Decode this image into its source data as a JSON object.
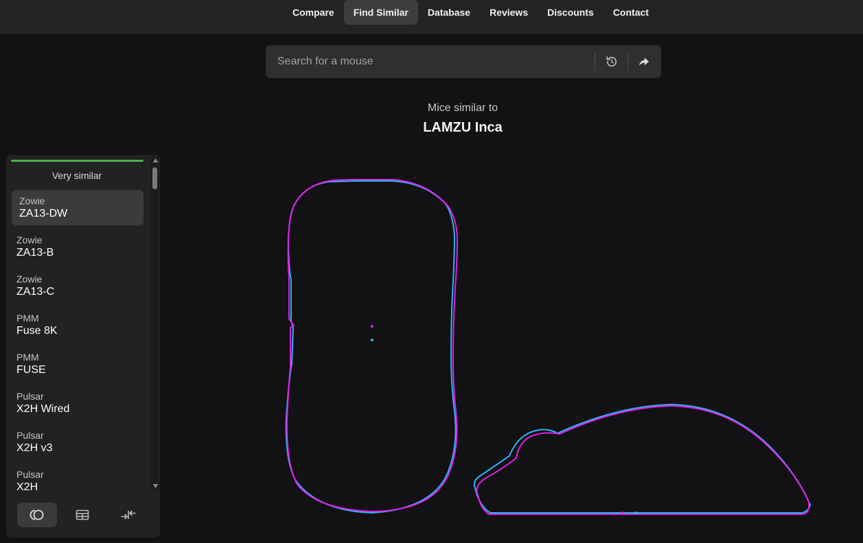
{
  "nav": {
    "items": [
      {
        "label": "Compare",
        "active": false
      },
      {
        "label": "Find Similar",
        "active": true
      },
      {
        "label": "Database",
        "active": false
      },
      {
        "label": "Reviews",
        "active": false
      },
      {
        "label": "Discounts",
        "active": false
      },
      {
        "label": "Contact",
        "active": false
      }
    ]
  },
  "search": {
    "placeholder": "Search for a mouse",
    "reset_icon": "refresh-icon",
    "share_icon": "share-arrow-icon"
  },
  "heading": {
    "subtitle": "Mice similar to",
    "title": "LAMZU Inca"
  },
  "sidebar": {
    "accent_color": "#4caf50",
    "section_title": "Very similar",
    "items": [
      {
        "brand": "Zowie",
        "model": "ZA13-DW"
      },
      {
        "brand": "Zowie",
        "model": "ZA13-B"
      },
      {
        "brand": "Zowie",
        "model": "ZA13-C"
      },
      {
        "brand": "PMM",
        "model": "Fuse 8K"
      },
      {
        "brand": "PMM",
        "model": "FUSE"
      },
      {
        "brand": "Pulsar",
        "model": "X2H Wired"
      },
      {
        "brand": "Pulsar",
        "model": "X2H v3"
      },
      {
        "brand": "Pulsar",
        "model": "X2H"
      }
    ],
    "selected_index": 0,
    "tools": [
      {
        "icon": "shape-overlay-icon",
        "active": true
      },
      {
        "icon": "table-grid-icon",
        "active": false
      },
      {
        "icon": "compare-arrows-icon",
        "active": false
      }
    ]
  },
  "shapes": {
    "reference_color": "#e020e8",
    "compare_color": "#29b6f6"
  }
}
